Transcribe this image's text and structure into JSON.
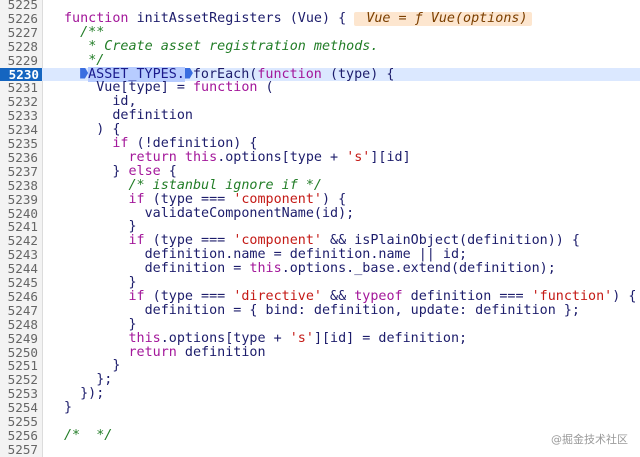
{
  "lines": [
    {
      "n": "5225",
      "indent": "",
      "parts": []
    },
    {
      "n": "5226",
      "indent": "",
      "parts": [
        {
          "t": "function ",
          "c": "kw"
        },
        {
          "t": "initAssetRegisters (Vue) { ",
          "c": "pl"
        },
        {
          "t": " Vue = ƒ Vue(options)",
          "c": "hint"
        }
      ]
    },
    {
      "n": "5227",
      "indent": "  ",
      "parts": [
        {
          "t": "/**",
          "c": "cm"
        }
      ]
    },
    {
      "n": "5228",
      "indent": "   ",
      "parts": [
        {
          "t": "* Create asset registration methods.",
          "c": "cm"
        }
      ]
    },
    {
      "n": "5229",
      "indent": "   ",
      "parts": [
        {
          "t": "*/",
          "c": "cm"
        }
      ]
    },
    {
      "n": "5230",
      "indent": "  ",
      "current": true,
      "parts": [
        {
          "t": "",
          "c": "bp"
        },
        {
          "t": "ASSET_TYPES.",
          "c": "sel"
        },
        {
          "t": "",
          "c": "bp"
        },
        {
          "t": "forEach(",
          "c": "pl"
        },
        {
          "t": "function ",
          "c": "kw"
        },
        {
          "t": "(type) {",
          "c": "pl"
        }
      ]
    },
    {
      "n": "5231",
      "indent": "    ",
      "parts": [
        {
          "t": "Vue[type] = ",
          "c": "pl"
        },
        {
          "t": "function",
          "c": "kw"
        },
        {
          "t": " (",
          "c": "pl"
        }
      ]
    },
    {
      "n": "5232",
      "indent": "      ",
      "parts": [
        {
          "t": "id,",
          "c": "pl"
        }
      ]
    },
    {
      "n": "5233",
      "indent": "      ",
      "parts": [
        {
          "t": "definition",
          "c": "pl"
        }
      ]
    },
    {
      "n": "5234",
      "indent": "    ",
      "parts": [
        {
          "t": ") {",
          "c": "pl"
        }
      ]
    },
    {
      "n": "5235",
      "indent": "      ",
      "parts": [
        {
          "t": "if",
          "c": "kw"
        },
        {
          "t": " (!definition) {",
          "c": "pl"
        }
      ]
    },
    {
      "n": "5236",
      "indent": "        ",
      "parts": [
        {
          "t": "return this",
          "c": "kw"
        },
        {
          "t": ".options[type + ",
          "c": "pl"
        },
        {
          "t": "'s'",
          "c": "str"
        },
        {
          "t": "][id]",
          "c": "pl"
        }
      ]
    },
    {
      "n": "5237",
      "indent": "      ",
      "parts": [
        {
          "t": "} ",
          "c": "pl"
        },
        {
          "t": "else",
          "c": "kw"
        },
        {
          "t": " {",
          "c": "pl"
        }
      ]
    },
    {
      "n": "5238",
      "indent": "        ",
      "parts": [
        {
          "t": "/* istanbul ignore if */",
          "c": "cm"
        }
      ]
    },
    {
      "n": "5239",
      "indent": "        ",
      "parts": [
        {
          "t": "if",
          "c": "kw"
        },
        {
          "t": " (type === ",
          "c": "pl"
        },
        {
          "t": "'component'",
          "c": "str"
        },
        {
          "t": ") {",
          "c": "pl"
        }
      ]
    },
    {
      "n": "5240",
      "indent": "          ",
      "parts": [
        {
          "t": "validateComponentName(id);",
          "c": "pl"
        }
      ]
    },
    {
      "n": "5241",
      "indent": "        ",
      "parts": [
        {
          "t": "}",
          "c": "pl"
        }
      ]
    },
    {
      "n": "5242",
      "indent": "        ",
      "parts": [
        {
          "t": "if",
          "c": "kw"
        },
        {
          "t": " (type === ",
          "c": "pl"
        },
        {
          "t": "'component'",
          "c": "str"
        },
        {
          "t": " && isPlainObject(definition)) {",
          "c": "pl"
        }
      ]
    },
    {
      "n": "5243",
      "indent": "          ",
      "parts": [
        {
          "t": "definition.name = definition.name || id;",
          "c": "pl"
        }
      ]
    },
    {
      "n": "5244",
      "indent": "          ",
      "parts": [
        {
          "t": "definition = ",
          "c": "pl"
        },
        {
          "t": "this",
          "c": "kw"
        },
        {
          "t": ".options._base.extend(definition);",
          "c": "pl"
        }
      ]
    },
    {
      "n": "5245",
      "indent": "        ",
      "parts": [
        {
          "t": "}",
          "c": "pl"
        }
      ]
    },
    {
      "n": "5246",
      "indent": "        ",
      "parts": [
        {
          "t": "if",
          "c": "kw"
        },
        {
          "t": " (type === ",
          "c": "pl"
        },
        {
          "t": "'directive'",
          "c": "str"
        },
        {
          "t": " && ",
          "c": "pl"
        },
        {
          "t": "typeof",
          "c": "kw"
        },
        {
          "t": " definition === ",
          "c": "pl"
        },
        {
          "t": "'function'",
          "c": "str"
        },
        {
          "t": ") {",
          "c": "pl"
        }
      ]
    },
    {
      "n": "5247",
      "indent": "          ",
      "parts": [
        {
          "t": "definition = { bind: definition, update: definition };",
          "c": "pl"
        }
      ]
    },
    {
      "n": "5248",
      "indent": "        ",
      "parts": [
        {
          "t": "}",
          "c": "pl"
        }
      ]
    },
    {
      "n": "5249",
      "indent": "        ",
      "parts": [
        {
          "t": "this",
          "c": "kw"
        },
        {
          "t": ".options[type + ",
          "c": "pl"
        },
        {
          "t": "'s'",
          "c": "str"
        },
        {
          "t": "][id] = definition;",
          "c": "pl"
        }
      ]
    },
    {
      "n": "5250",
      "indent": "        ",
      "parts": [
        {
          "t": "return",
          "c": "kw"
        },
        {
          "t": " definition",
          "c": "pl"
        }
      ]
    },
    {
      "n": "5251",
      "indent": "      ",
      "parts": [
        {
          "t": "}",
          "c": "pl"
        }
      ]
    },
    {
      "n": "5252",
      "indent": "    ",
      "parts": [
        {
          "t": "};",
          "c": "pl"
        }
      ]
    },
    {
      "n": "5253",
      "indent": "  ",
      "parts": [
        {
          "t": "});",
          "c": "pl"
        }
      ]
    },
    {
      "n": "5254",
      "indent": "",
      "parts": [
        {
          "t": "}",
          "c": "pl"
        }
      ]
    },
    {
      "n": "5255",
      "indent": "",
      "parts": []
    },
    {
      "n": "5256",
      "indent": "",
      "parts": [
        {
          "t": "/*  */",
          "c": "cm"
        }
      ]
    },
    {
      "n": "5257",
      "indent": "",
      "parts": []
    }
  ],
  "watermark": "@掘金技术社区"
}
